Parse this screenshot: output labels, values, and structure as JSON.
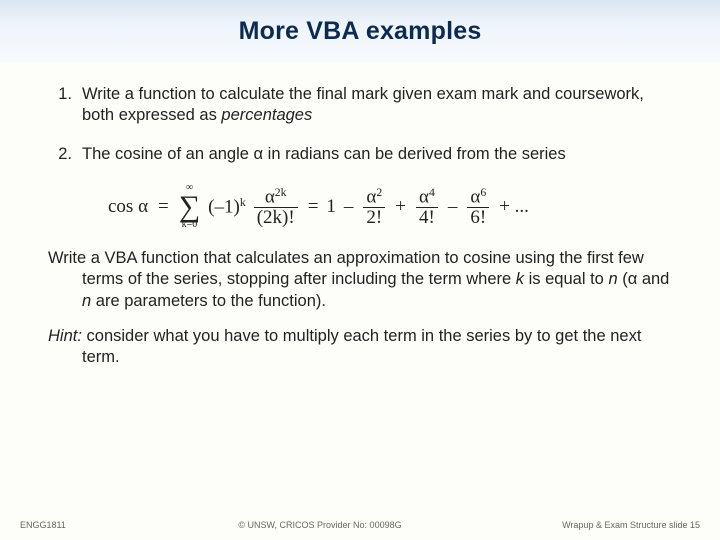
{
  "title": "More VBA examples",
  "items": [
    {
      "num": "1.",
      "text_a": "Write a function to calculate the final mark given exam mark and coursework, both expressed as ",
      "text_em": "percentages"
    },
    {
      "num": "2.",
      "text_a": "The cosine of an angle α in radians can be derived from the series"
    }
  ],
  "formula": {
    "lhs": "cos α",
    "eq1": "=",
    "sum_top": "∞",
    "sum_sym": "∑",
    "sum_bot": "k=0",
    "coef": "(–1)",
    "coef_sup": "k",
    "f1_num_base": "α",
    "f1_num_sup": "2k",
    "f1_den": "(2k)!",
    "eq2": "=",
    "t1": "1",
    "minus": "–",
    "plus": "+",
    "f2_num_base": "α",
    "f2_num_sup": "2",
    "f2_den": "2!",
    "f3_num_base": "α",
    "f3_num_sup": "4",
    "f3_den": "4!",
    "f4_num_base": "α",
    "f4_num_sup": "6",
    "f4_den": "6!",
    "dots": "+ ..."
  },
  "para1_a": "Write a VBA function that calculates an approximation to cosine using the first few terms of the series, stopping after including the term where ",
  "para1_k": "k",
  "para1_b": " is equal to ",
  "para1_n": "n",
  "para1_c": "  (α and ",
  "para1_n2": "n",
  "para1_d": " are parameters to the function).",
  "hint_label": "Hint:",
  "hint_text": " consider what you have to multiply each term in the series by to get the next term.",
  "footer": {
    "left": "ENGG1811",
    "mid": "© UNSW,  CRICOS Provider No: 00098G",
    "right": "Wrapup & Exam Structure slide 15"
  }
}
